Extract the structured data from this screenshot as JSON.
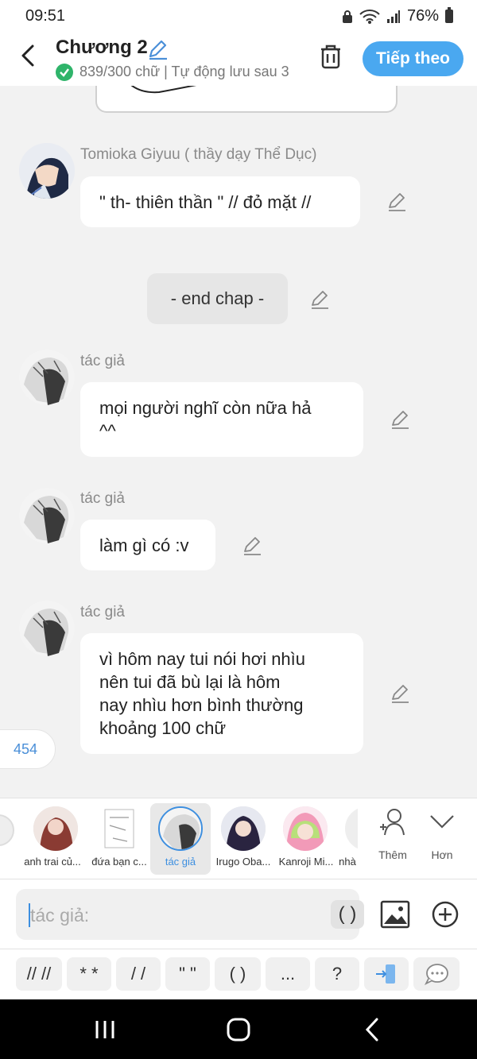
{
  "status_bar": {
    "time": "09:51",
    "battery": "76%"
  },
  "header": {
    "chapter_title": "Chương 2",
    "subtitle": "839/300 chữ | Tự động lưu sau 3",
    "next_button": "Tiếp theo"
  },
  "messages": [
    {
      "speaker": "Tomioka Giyuu ( thầy dạy Thể Dục)",
      "text": "\" th- thiên thần \" // đỏ mặt //"
    },
    {
      "narration": "- end chap -"
    },
    {
      "speaker": "tác giả",
      "lines": [
        "mọi người nghĩ còn nữa hả",
        "^^"
      ]
    },
    {
      "speaker": "tác giả",
      "text": "làm gì có :v"
    },
    {
      "speaker": "tác giả",
      "lines": [
        "vì hôm nay tui nói hơi nhìu",
        "nên tui đã bù lại là hôm",
        "nay nhìu hơn bình thường",
        "khoảng 100 chữ"
      ]
    }
  ],
  "count_badge": "454",
  "characters": [
    {
      "name": "anh trai củ..."
    },
    {
      "name": "đứa bạn c..."
    },
    {
      "name": "tác giả",
      "active": true
    },
    {
      "name": "Irugo Oba..."
    },
    {
      "name": "Kanroji Mi..."
    },
    {
      "name": "nhà"
    }
  ],
  "strip_buttons": {
    "more": "Thêm",
    "expand": "Hơn"
  },
  "input": {
    "placeholder": "tác giả:",
    "paren_button": "( )"
  },
  "quick_symbols": [
    "// //",
    "* *",
    "/ /",
    "\" \"",
    "( )",
    "...",
    "?"
  ],
  "colors": {
    "accent": "#4aa8f0",
    "check": "#2fb46a",
    "active_text": "#3d8fe0"
  },
  "icons": [
    "back-icon",
    "pencil-icon",
    "check-icon",
    "trash-icon",
    "edit-icon",
    "add-person-icon",
    "chevron-down-icon",
    "image-icon",
    "plus-circle-icon",
    "transfer-icon",
    "chat-bubble-icon",
    "recent-apps-icon",
    "home-icon",
    "nav-back-icon"
  ]
}
